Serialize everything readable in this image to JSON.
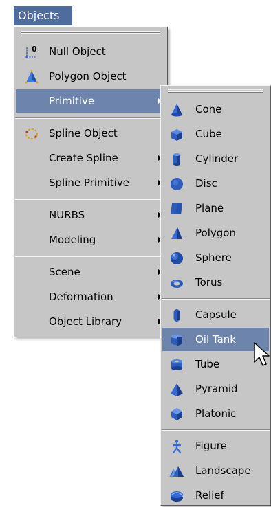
{
  "menubar": {
    "title": "Objects"
  },
  "main_menu": {
    "items": [
      {
        "label": "Null Object",
        "icon": "null-object-icon",
        "submenu": false
      },
      {
        "label": "Polygon Object",
        "icon": "polygon-object-icon",
        "submenu": false
      },
      {
        "label": "Primitive",
        "icon": "",
        "submenu": true,
        "highlighted": true
      },
      {
        "label": "Spline Object",
        "icon": "spline-object-icon",
        "submenu": false
      },
      {
        "label": "Create Spline",
        "icon": "",
        "submenu": true
      },
      {
        "label": "Spline Primitive",
        "icon": "",
        "submenu": true
      },
      {
        "label": "NURBS",
        "icon": "",
        "submenu": true
      },
      {
        "label": "Modeling",
        "icon": "",
        "submenu": true
      },
      {
        "label": "Scene",
        "icon": "",
        "submenu": true
      },
      {
        "label": "Deformation",
        "icon": "",
        "submenu": true
      },
      {
        "label": "Object Library",
        "icon": "",
        "submenu": true
      }
    ]
  },
  "primitive_submenu": {
    "items": [
      {
        "label": "Cone",
        "icon": "cone-icon"
      },
      {
        "label": "Cube",
        "icon": "cube-icon"
      },
      {
        "label": "Cylinder",
        "icon": "cylinder-icon"
      },
      {
        "label": "Disc",
        "icon": "disc-icon"
      },
      {
        "label": "Plane",
        "icon": "plane-icon"
      },
      {
        "label": "Polygon",
        "icon": "polygon-icon"
      },
      {
        "label": "Sphere",
        "icon": "sphere-icon"
      },
      {
        "label": "Torus",
        "icon": "torus-icon"
      },
      {
        "label": "Capsule",
        "icon": "capsule-icon"
      },
      {
        "label": "Oil Tank",
        "icon": "oil-tank-icon",
        "highlighted": true
      },
      {
        "label": "Tube",
        "icon": "tube-icon"
      },
      {
        "label": "Pyramid",
        "icon": "pyramid-icon"
      },
      {
        "label": "Platonic",
        "icon": "platonic-icon"
      },
      {
        "label": "Figure",
        "icon": "figure-icon"
      },
      {
        "label": "Landscape",
        "icon": "landscape-icon"
      },
      {
        "label": "Relief",
        "icon": "relief-icon"
      }
    ]
  },
  "colors": {
    "menu_bg": "#c6c6c6",
    "highlight": "#6d84ac",
    "menubar_active": "#4f6c9e",
    "icon_blue": "#2f5dbb"
  }
}
